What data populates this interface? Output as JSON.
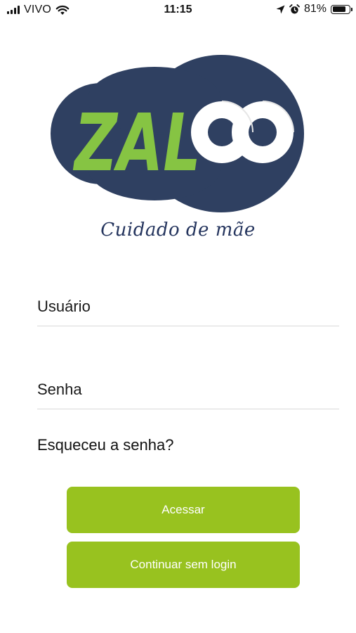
{
  "status_bar": {
    "carrier": "VIVO",
    "time": "11:15",
    "battery_percent": "81%",
    "battery_level": 0.81,
    "icons": [
      "signal-icon",
      "wifi-icon",
      "location-arrow-icon",
      "alarm-icon",
      "battery-icon"
    ]
  },
  "logo": {
    "text_left": "ZAL",
    "tagline": "Cuidado de mãe",
    "colors": {
      "navy": "#2f4061",
      "green": "#86c443",
      "white": "#ffffff"
    }
  },
  "form": {
    "username_placeholder": "Usuário",
    "password_placeholder": "Senha",
    "forgot_password": "Esqueceu a senha?"
  },
  "buttons": {
    "login_label": "Acessar",
    "guest_label": "Continuar sem login",
    "color": "#98c21f"
  }
}
